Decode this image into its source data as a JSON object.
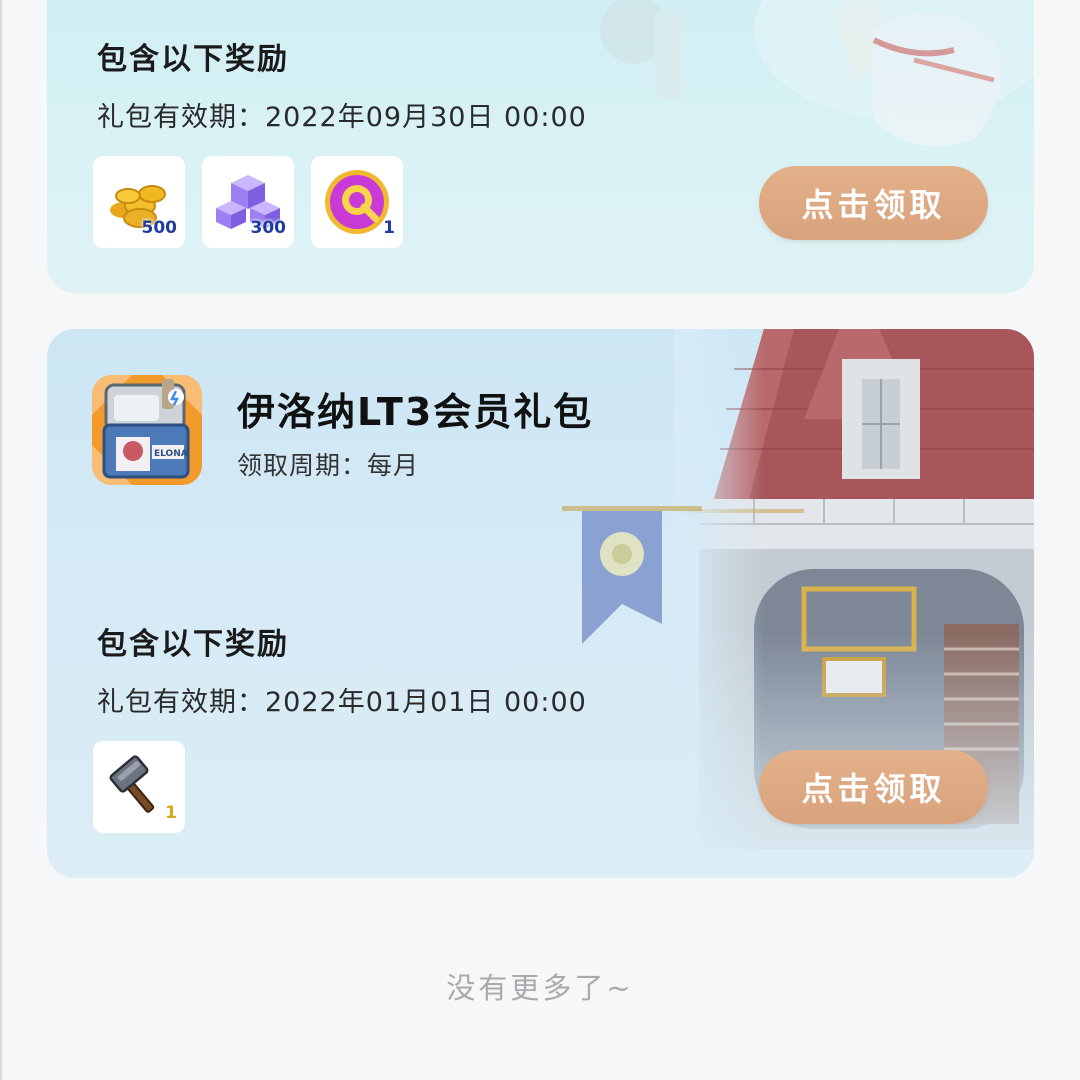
{
  "cards": [
    {
      "rewards_heading": "包含以下奖励",
      "validity": "礼包有效期：2022年09月30日 00:00",
      "rewards": [
        {
          "icon": "gold-coins-icon",
          "count": "500"
        },
        {
          "icon": "purple-cubes-icon",
          "count": "300"
        },
        {
          "icon": "q-coin-icon",
          "count": "1"
        }
      ],
      "claim_label": "点击领取"
    },
    {
      "game_icon": "elona-app-icon",
      "title": "伊洛纳LT3会员礼包",
      "period": "领取周期：每月",
      "rewards_heading": "包含以下奖励",
      "validity": "礼包有效期：2022年01月01日 00:00",
      "rewards": [
        {
          "icon": "hammer-icon",
          "count": "1"
        }
      ],
      "claim_label": "点击领取"
    }
  ],
  "footer": {
    "no_more": "没有更多了~"
  }
}
